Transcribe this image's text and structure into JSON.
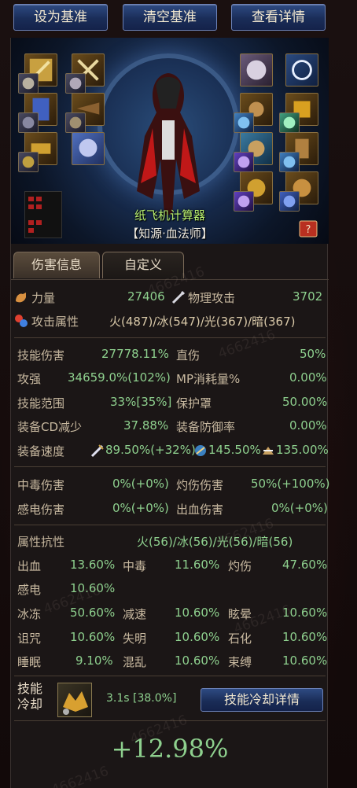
{
  "toolbar": {
    "set_baseline": "设为基准",
    "clear_baseline": "清空基准",
    "view_details": "查看详情"
  },
  "character": {
    "name": "纸飞机计算器",
    "class": "【知源·血法师】"
  },
  "tabs": [
    {
      "label": "伤害信息",
      "active": true
    },
    {
      "label": "自定义",
      "active": false
    }
  ],
  "primary": {
    "strength_label": "力量",
    "strength_value": "27406",
    "phys_atk_label": "物理攻击",
    "phys_atk_value": "3702",
    "element_label": "攻击属性",
    "element_value": "火(487)/冰(547)/光(367)/暗(367)"
  },
  "damage": {
    "skill_dmg_label": "技能伤害",
    "skill_dmg_value": "27778.11%",
    "crit_label": "直伤",
    "crit_value": "50%",
    "atk_boost_label": "攻强",
    "atk_boost_value": "34659.0%(102%)",
    "mp_label": "MP消耗量%",
    "mp_value": "0.00%",
    "range_label": "技能范围",
    "range_value": "33%[35%]",
    "shield_label": "保护罩",
    "shield_value": "50.00%",
    "cd_reduce_label": "装备CD减少",
    "cd_reduce_value": "37.88%",
    "def_rate_label": "装备防御率",
    "def_rate_value": "0.00%",
    "speed_label": "装备速度",
    "speed_atk": "89.50%(+32%)",
    "speed_cast": "145.50%",
    "speed_move": "135.00%"
  },
  "dot": {
    "poison_label": "中毒伤害",
    "poison_value": "0%(+0%)",
    "burn_label": "灼伤伤害",
    "burn_value": "50%(+100%)",
    "shock_label": "感电伤害",
    "shock_value": "0%(+0%)",
    "bleed_label": "出血伤害",
    "bleed_value": "0%(+0%)"
  },
  "resist": {
    "title": "属性抗性",
    "elements": "火(56)/冰(56)/光(56)/暗(56)",
    "rows": [
      [
        {
          "l": "出血",
          "v": "13.60%"
        },
        {
          "l": "中毒",
          "v": "11.60%"
        },
        {
          "l": "灼伤",
          "v": "47.60%"
        }
      ],
      [
        {
          "l": "感电",
          "v": "10.60%"
        }
      ],
      [
        {
          "l": "冰冻",
          "v": "50.60%"
        },
        {
          "l": "减速",
          "v": "10.60%"
        },
        {
          "l": "眩晕",
          "v": "10.60%"
        }
      ],
      [
        {
          "l": "诅咒",
          "v": "10.60%"
        },
        {
          "l": "失明",
          "v": "10.60%"
        },
        {
          "l": "石化",
          "v": "10.60%"
        }
      ],
      [
        {
          "l": "睡眠",
          "v": "9.10%"
        },
        {
          "l": "混乱",
          "v": "10.60%"
        },
        {
          "l": "束缚",
          "v": "10.60%"
        }
      ]
    ]
  },
  "cooldown": {
    "label_line1": "技能",
    "label_line2": "冷却",
    "value": "3.1s [38.0%]",
    "button": "技能冷却详情"
  },
  "total": "+12.98%",
  "watermark": "4662416",
  "colors": {
    "button_blue": "#1a2d58",
    "value_green": "#8ed08e",
    "name_green": "#b8f070"
  }
}
